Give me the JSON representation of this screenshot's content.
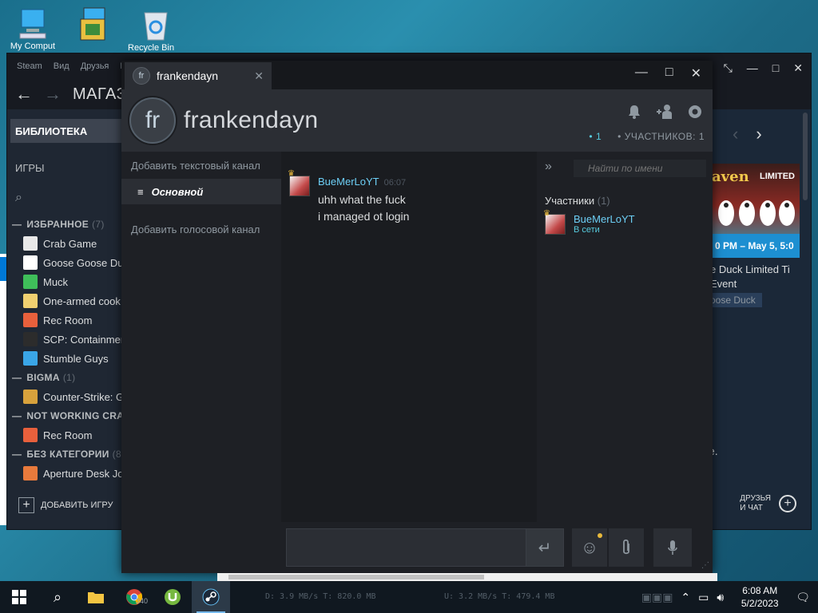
{
  "desktop": {
    "icons": [
      {
        "name": "computer-icon",
        "label": "My Comput"
      },
      {
        "name": "setup-icon",
        "label": ""
      },
      {
        "name": "recycle-bin-icon",
        "label": "Recycle Bin"
      }
    ]
  },
  "library": {
    "menu": [
      "Steam",
      "Вид",
      "Друзья",
      "И"
    ],
    "nav_title": "МАГАЗ",
    "library_label": "БИБЛИОТЕКА",
    "games_label": "ИГРЫ",
    "sections": [
      {
        "title": "ИЗБРАННОЕ",
        "count": "(7)",
        "items": [
          {
            "name": "Crab Game",
            "color": "#e8e8e8"
          },
          {
            "name": "Goose Goose Du",
            "color": "#ffffff"
          },
          {
            "name": "Muck",
            "color": "#3fbf5a"
          },
          {
            "name": "One-armed cook",
            "color": "#f0d070"
          },
          {
            "name": "Rec Room",
            "color": "#e8603c"
          },
          {
            "name": "SCP: Containmer",
            "color": "#2c2c2c"
          },
          {
            "name": "Stumble Guys",
            "color": "#3aa6e8"
          }
        ]
      },
      {
        "title": "BIGMA",
        "count": "(1)",
        "items": [
          {
            "name": "Counter-Strike: G",
            "color": "#d8a23c"
          }
        ]
      },
      {
        "title": "NOT WORKING CRA",
        "count": "",
        "items": [
          {
            "name": "Rec Room",
            "color": "#e8603c"
          }
        ]
      },
      {
        "title": "БЕЗ КАТЕГОРИИ",
        "count": "(8",
        "items": [
          {
            "name": "Aperture Desk Jo",
            "color": "#e87a3c"
          }
        ]
      }
    ],
    "add_game": "ДОБАВИТЬ ИГРУ",
    "friends_chat": [
      "ДРУЗЬЯ",
      "И ЧАТ"
    ],
    "promo": {
      "title": "aven",
      "badge": "LIMITED",
      "date": "0 PM – May 5, 5:0",
      "line1": "e Duck Limited Ti",
      "line2": "Event",
      "tag": "oose Duck"
    },
    "edge_text": "e."
  },
  "chat": {
    "tab_title": "frankendayn",
    "avatar_text": "fr",
    "group_name": "frankendayn",
    "online_count": "1",
    "members_count_label": "УЧАСТНИКОВ: 1",
    "add_text_channel": "Добавить текстовый канал",
    "main_channel": "Основной",
    "add_voice_channel": "Добавить голосовой канал",
    "messages": [
      {
        "author": "BueMerLoYT",
        "time": "06:07",
        "lines": [
          "uhh what the fuck",
          "i managed ot login"
        ]
      }
    ],
    "member_search_placeholder": "Найти по имени",
    "members_title": "Участники",
    "members_count": "(1)",
    "members": [
      {
        "name": "BueMerLoYT",
        "status": "В сети"
      }
    ]
  },
  "taskbar": {
    "chrome_badge": "340",
    "download_stat": "D: 3.9 MB/s T: 820.0 MB",
    "upload_stat": "U: 3.2 MB/s T: 479.4 MB",
    "time": "6:08 AM",
    "date": "5/2/2023"
  }
}
